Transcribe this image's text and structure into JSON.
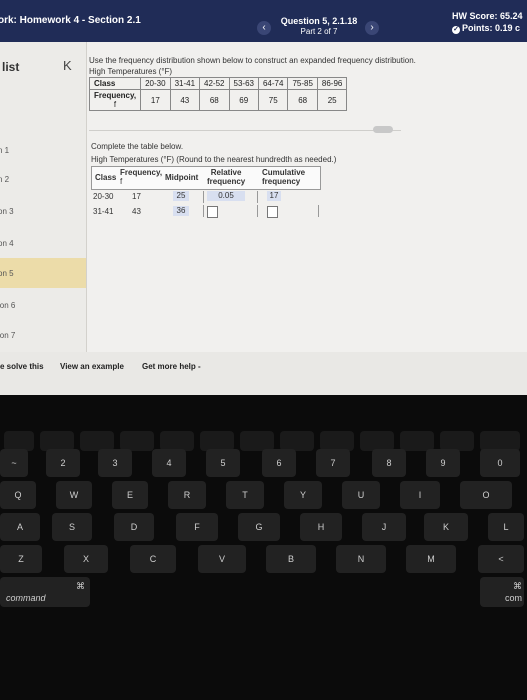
{
  "header": {
    "title": "ork: Homework 4 - Section 2.1",
    "question_title": "Question 5, 2.1.18",
    "question_part": "Part 2 of 7",
    "prev_icon": "‹",
    "next_icon": "›",
    "hw_score": "HW Score: 65.24",
    "points": "Points: 0.19 c"
  },
  "sidebar": {
    "list_label": "list",
    "collapse_icon": "K",
    "items": [
      {
        "label": "n 1"
      },
      {
        "label": "n 2"
      },
      {
        "label": "on 3"
      },
      {
        "label": "on 4"
      },
      {
        "label": "on 5"
      },
      {
        "label": "ion 6"
      },
      {
        "label": "ion 7"
      }
    ]
  },
  "question": {
    "prompt": "Use the frequency distribution shown below to construct an expanded frequency distribution.",
    "freq_caption": "High Temperatures (°F)",
    "freq_table": {
      "row1_header": "Class",
      "classes": [
        "20-30",
        "31-41",
        "42-52",
        "53-63",
        "64-74",
        "75-85",
        "86-96"
      ],
      "row2_header": "Frequency,",
      "row2_sub": "f",
      "frequencies": [
        "17",
        "43",
        "68",
        "69",
        "75",
        "68",
        "25"
      ]
    },
    "complete_text": "Complete the table below.",
    "expanded_caption": "High Temperatures (°F)    (Round to the nearest hundredth as needed.)",
    "expanded_table": {
      "col_class": "Class",
      "col_frequency": "Frequency,",
      "col_frequency_sub": "f",
      "col_midpoint": "Midpoint",
      "col_relative": "Relative",
      "col_relative_sub": "frequency",
      "col_cumulative": "Cumulative",
      "col_cumulative_sub": "frequency",
      "rows": [
        {
          "class": "20-30",
          "frequency": "17",
          "midpoint": "25",
          "relative": "0.05",
          "cumulative": "17"
        },
        {
          "class": "31-41",
          "frequency": "43",
          "midpoint": "36",
          "relative": "",
          "cumulative": ""
        }
      ]
    }
  },
  "toolbar": {
    "solve_label": "e solve this",
    "example_label": "View an example",
    "help_label": "Get more help -"
  },
  "keyboard": {
    "fn_row": [
      "",
      "",
      "",
      "",
      "",
      "",
      "",
      "",
      "",
      "",
      "",
      "",
      ""
    ],
    "row1": [
      "~",
      "2",
      "3",
      "4",
      "5",
      "6",
      "7",
      "8",
      "9",
      "0"
    ],
    "row2": [
      "Q",
      "W",
      "E",
      "R",
      "T",
      "Y",
      "U",
      "I",
      "O"
    ],
    "row3": [
      "A",
      "S",
      "D",
      "F",
      "G",
      "H",
      "J",
      "K",
      "L"
    ],
    "row4": [
      "Z",
      "X",
      "C",
      "V",
      "B",
      "N",
      "M",
      "<"
    ],
    "cmd_left_symbol": "⌘",
    "cmd_left_label": "command",
    "cmd_right_symbol": "⌘",
    "cmd_right_label": "com"
  },
  "colors": {
    "header_bg": "#202c57",
    "active_item": "#ecdca9",
    "given_cell": "#d8dff0"
  }
}
